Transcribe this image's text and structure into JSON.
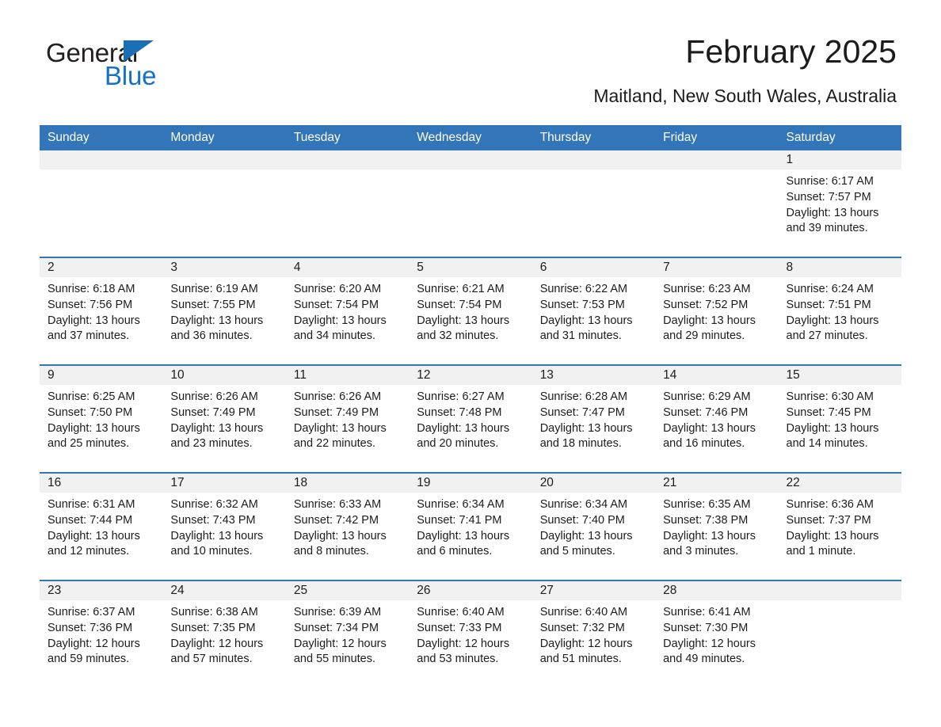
{
  "brand": {
    "name_part1": "General",
    "name_part2": "Blue",
    "accent_color": "#1372c4",
    "triangle_color": "#1a6fb5"
  },
  "header": {
    "title": "February 2025",
    "subtitle": "Maitland, New South Wales, Australia",
    "header_bg": "#3275b8",
    "header_text_color": "#ffffff"
  },
  "weekdays": [
    "Sunday",
    "Monday",
    "Tuesday",
    "Wednesday",
    "Thursday",
    "Friday",
    "Saturday"
  ],
  "labels": {
    "sunrise": "Sunrise:",
    "sunset": "Sunset:",
    "daylight": "Daylight:"
  },
  "weeks": [
    [
      {
        "day": ""
      },
      {
        "day": ""
      },
      {
        "day": ""
      },
      {
        "day": ""
      },
      {
        "day": ""
      },
      {
        "day": ""
      },
      {
        "day": "1",
        "sunrise": "Sunrise: 6:17 AM",
        "sunset": "Sunset: 7:57 PM",
        "daylight": "Daylight: 13 hours and 39 minutes."
      }
    ],
    [
      {
        "day": "2",
        "sunrise": "Sunrise: 6:18 AM",
        "sunset": "Sunset: 7:56 PM",
        "daylight": "Daylight: 13 hours and 37 minutes."
      },
      {
        "day": "3",
        "sunrise": "Sunrise: 6:19 AM",
        "sunset": "Sunset: 7:55 PM",
        "daylight": "Daylight: 13 hours and 36 minutes."
      },
      {
        "day": "4",
        "sunrise": "Sunrise: 6:20 AM",
        "sunset": "Sunset: 7:54 PM",
        "daylight": "Daylight: 13 hours and 34 minutes."
      },
      {
        "day": "5",
        "sunrise": "Sunrise: 6:21 AM",
        "sunset": "Sunset: 7:54 PM",
        "daylight": "Daylight: 13 hours and 32 minutes."
      },
      {
        "day": "6",
        "sunrise": "Sunrise: 6:22 AM",
        "sunset": "Sunset: 7:53 PM",
        "daylight": "Daylight: 13 hours and 31 minutes."
      },
      {
        "day": "7",
        "sunrise": "Sunrise: 6:23 AM",
        "sunset": "Sunset: 7:52 PM",
        "daylight": "Daylight: 13 hours and 29 minutes."
      },
      {
        "day": "8",
        "sunrise": "Sunrise: 6:24 AM",
        "sunset": "Sunset: 7:51 PM",
        "daylight": "Daylight: 13 hours and 27 minutes."
      }
    ],
    [
      {
        "day": "9",
        "sunrise": "Sunrise: 6:25 AM",
        "sunset": "Sunset: 7:50 PM",
        "daylight": "Daylight: 13 hours and 25 minutes."
      },
      {
        "day": "10",
        "sunrise": "Sunrise: 6:26 AM",
        "sunset": "Sunset: 7:49 PM",
        "daylight": "Daylight: 13 hours and 23 minutes."
      },
      {
        "day": "11",
        "sunrise": "Sunrise: 6:26 AM",
        "sunset": "Sunset: 7:49 PM",
        "daylight": "Daylight: 13 hours and 22 minutes."
      },
      {
        "day": "12",
        "sunrise": "Sunrise: 6:27 AM",
        "sunset": "Sunset: 7:48 PM",
        "daylight": "Daylight: 13 hours and 20 minutes."
      },
      {
        "day": "13",
        "sunrise": "Sunrise: 6:28 AM",
        "sunset": "Sunset: 7:47 PM",
        "daylight": "Daylight: 13 hours and 18 minutes."
      },
      {
        "day": "14",
        "sunrise": "Sunrise: 6:29 AM",
        "sunset": "Sunset: 7:46 PM",
        "daylight": "Daylight: 13 hours and 16 minutes."
      },
      {
        "day": "15",
        "sunrise": "Sunrise: 6:30 AM",
        "sunset": "Sunset: 7:45 PM",
        "daylight": "Daylight: 13 hours and 14 minutes."
      }
    ],
    [
      {
        "day": "16",
        "sunrise": "Sunrise: 6:31 AM",
        "sunset": "Sunset: 7:44 PM",
        "daylight": "Daylight: 13 hours and 12 minutes."
      },
      {
        "day": "17",
        "sunrise": "Sunrise: 6:32 AM",
        "sunset": "Sunset: 7:43 PM",
        "daylight": "Daylight: 13 hours and 10 minutes."
      },
      {
        "day": "18",
        "sunrise": "Sunrise: 6:33 AM",
        "sunset": "Sunset: 7:42 PM",
        "daylight": "Daylight: 13 hours and 8 minutes."
      },
      {
        "day": "19",
        "sunrise": "Sunrise: 6:34 AM",
        "sunset": "Sunset: 7:41 PM",
        "daylight": "Daylight: 13 hours and 6 minutes."
      },
      {
        "day": "20",
        "sunrise": "Sunrise: 6:34 AM",
        "sunset": "Sunset: 7:40 PM",
        "daylight": "Daylight: 13 hours and 5 minutes."
      },
      {
        "day": "21",
        "sunrise": "Sunrise: 6:35 AM",
        "sunset": "Sunset: 7:38 PM",
        "daylight": "Daylight: 13 hours and 3 minutes."
      },
      {
        "day": "22",
        "sunrise": "Sunrise: 6:36 AM",
        "sunset": "Sunset: 7:37 PM",
        "daylight": "Daylight: 13 hours and 1 minute."
      }
    ],
    [
      {
        "day": "23",
        "sunrise": "Sunrise: 6:37 AM",
        "sunset": "Sunset: 7:36 PM",
        "daylight": "Daylight: 12 hours and 59 minutes."
      },
      {
        "day": "24",
        "sunrise": "Sunrise: 6:38 AM",
        "sunset": "Sunset: 7:35 PM",
        "daylight": "Daylight: 12 hours and 57 minutes."
      },
      {
        "day": "25",
        "sunrise": "Sunrise: 6:39 AM",
        "sunset": "Sunset: 7:34 PM",
        "daylight": "Daylight: 12 hours and 55 minutes."
      },
      {
        "day": "26",
        "sunrise": "Sunrise: 6:40 AM",
        "sunset": "Sunset: 7:33 PM",
        "daylight": "Daylight: 12 hours and 53 minutes."
      },
      {
        "day": "27",
        "sunrise": "Sunrise: 6:40 AM",
        "sunset": "Sunset: 7:32 PM",
        "daylight": "Daylight: 12 hours and 51 minutes."
      },
      {
        "day": "28",
        "sunrise": "Sunrise: 6:41 AM",
        "sunset": "Sunset: 7:30 PM",
        "daylight": "Daylight: 12 hours and 49 minutes."
      },
      {
        "day": ""
      }
    ]
  ]
}
